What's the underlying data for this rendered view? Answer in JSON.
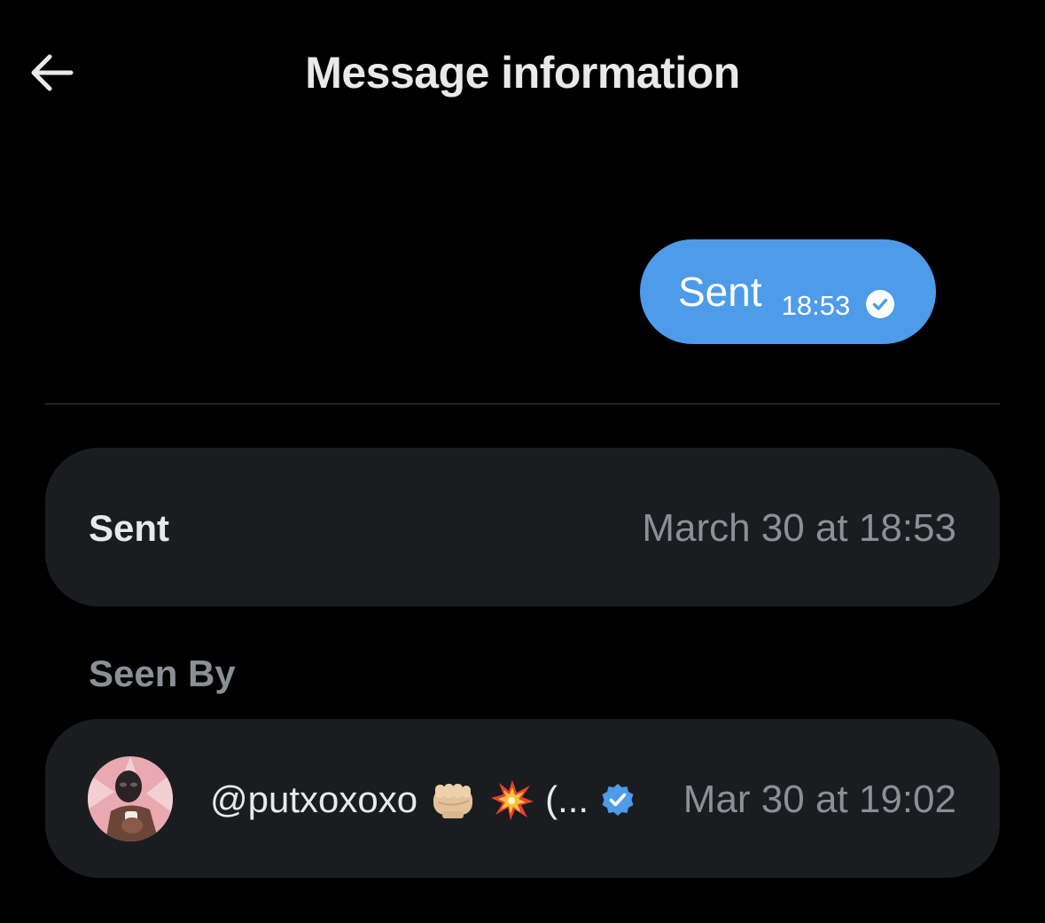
{
  "header": {
    "title": "Message information",
    "back_icon": "arrow-left-icon"
  },
  "message": {
    "text": "Sent",
    "time": "18:53",
    "status_icon": "check-circle-icon",
    "bubble_color": "#4d9be9"
  },
  "sent_row": {
    "label": "Sent",
    "value": "March 30 at 18:53"
  },
  "seen_by": {
    "heading": "Seen By",
    "entries": [
      {
        "handle": "@putxoxoxo",
        "emoji_icons": [
          "fist-emoji-icon",
          "collision-emoji-icon"
        ],
        "truncated_suffix": "(...",
        "verified_icon": "verified-badge-icon",
        "time": "Mar 30 at 19:02"
      }
    ]
  },
  "colors": {
    "background": "#000000",
    "card": "#1b1c20",
    "primary_text": "#e7e9ea",
    "secondary_text": "#8b8f96",
    "accent": "#4d9be9"
  }
}
